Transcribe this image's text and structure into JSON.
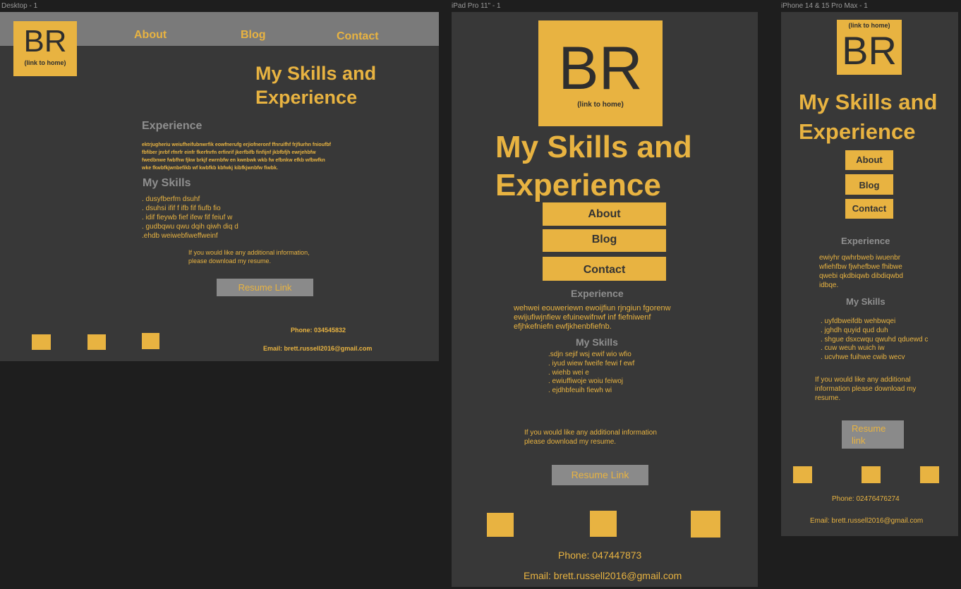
{
  "frames": {
    "desktop": {
      "label": "Desktop - 1",
      "logo_initials": "BR",
      "logo_link": "(link to home)",
      "nav": [
        "About",
        "Blog",
        "Contact"
      ],
      "title": "My Skills and\nExperience",
      "experience_heading": "Experience",
      "experience_text": "ektrjugheriu weiufheifubnwrfik eowfnerufg erjiofneronf ffnruifhf frjfiurhn fnioufbf\nfbfiber jnrbf  rfnrfr  einfr fkerfnrfn erfinrif jkerfbifb finfijnf jkbfbfjh ewrjehbfw\nfwedbnwe fwbfhw fjkw brkjf ewrnbfw en kwnbwk wkb fw efbnkw efkb wfbwfkn\nwke fkwbfkjwnbefikb wf kwbfkb kbfwkj kibfkjwnbfw fiwbk.",
      "skills_heading": "My Skills",
      "skills": [
        ". dusyfberfm dsuhf",
        ". dsuhsi ifif f ifb fif fiufb  fio",
        ". idif fieywb fief ifew fif feiuf w",
        ". gudbqwu qwu dqih qiwh diq d",
        ".ehdb  weiwebfiweffweinf"
      ],
      "additional_info": "If you would like any additional information,\nplease download my resume.",
      "resume_button": "Resume Link",
      "phone": "Phone: 034545832",
      "email": "Email: brett.russell2016@gmail.com"
    },
    "ipad": {
      "label": "iPad Pro 11\" - 1",
      "logo_initials": "BR",
      "logo_link": "(link to home)",
      "title": "My Skills and\nExperience",
      "nav": [
        "About",
        "Blog",
        "Contact"
      ],
      "experience_heading": "Experience",
      "experience_text": "wehwei eouweriewn ewoijfiun rjngiun fgorenw\newijufiwjnfiew efuinewifnwf inf fiefniwenf\nefjhkefniefn ewfjkhenbfiefnb.",
      "skills_heading": "My Skills",
      "skills": [
        ".sdjn sejif wsj ewif wio wfio",
        ". iyud wiew fweife fewi f ewf",
        ". wiehb wei e",
        ". ewiuffiwoje woiu feiwoj",
        ". ejdhbfeuih fiewh wi"
      ],
      "additional_info": "If you would like any additional information\nplease download my resume.",
      "resume_button": "Resume Link",
      "phone": "Phone: 047447873",
      "email": "Email: brett.russell2016@gmail.com"
    },
    "iphone": {
      "label": "iPhone 14 & 15 Pro Max - 1",
      "logo_initials": "BR",
      "logo_link": "(link to home)",
      "title": "My Skills and\nExperience",
      "nav": [
        "About",
        "Blog",
        "Contact"
      ],
      "experience_heading": "Experience",
      "experience_text": "ewiyhr qwhrbweb iwuenbr\nwfiehfbw fjwhefbwe fhibwe\nqwebi qkdbiqwb dibdiqwbd\nidbqe.",
      "skills_heading": "My Skills",
      "skills": [
        ". uyfdbweifdb wehbwqei",
        ". jghdh quyid qud duh",
        ". shgue dsxcwqu qwuhd qduewd c",
        ". cuw weuh wuich iw",
        ". ucvhwe fuihwe cwib wecv"
      ],
      "additional_info": "If you would like any additional\ninformation please download my\nresume.",
      "resume_button": "Resume\nlink",
      "phone": "Phone: 02476476274",
      "email": "Email: brett.russell2016@gmail.com"
    }
  },
  "colors": {
    "accent": "#e8b341",
    "frame_bg": "#383838",
    "canvas_bg": "#1e1e1e",
    "muted": "#8f8f8f"
  }
}
